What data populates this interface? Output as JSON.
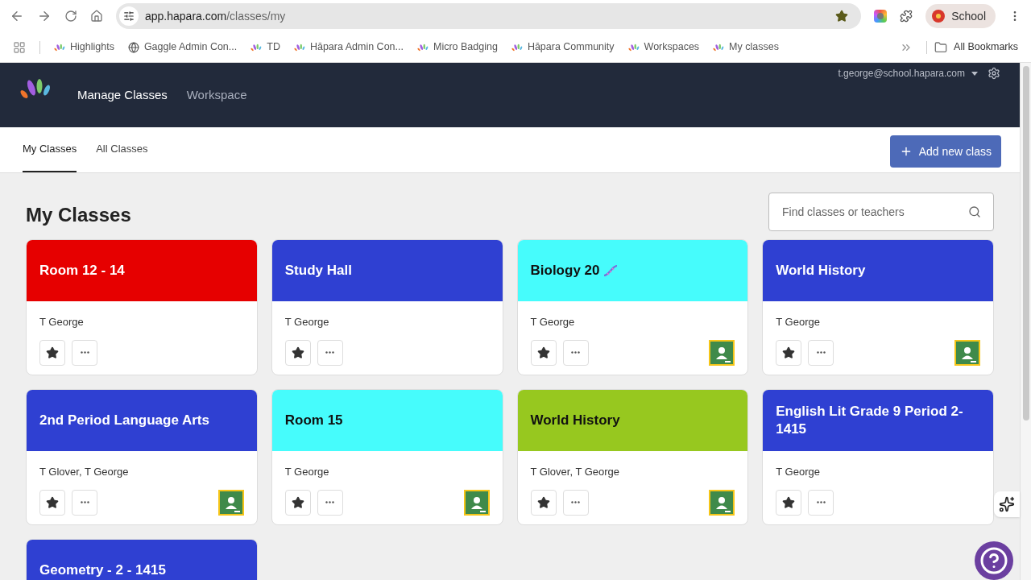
{
  "browser": {
    "url_host": "app.hapara.com",
    "url_path": "/classes/my",
    "profile": "School",
    "bookmarks": [
      {
        "label": "Highlights",
        "kind": "hapara"
      },
      {
        "label": "Gaggle Admin Con...",
        "kind": "globe"
      },
      {
        "label": "TD",
        "kind": "hapara"
      },
      {
        "label": "Hāpara Admin Con...",
        "kind": "hapara"
      },
      {
        "label": "Micro Badging",
        "kind": "hapara"
      },
      {
        "label": "Hāpara Community",
        "kind": "hapara"
      },
      {
        "label": "Workspaces",
        "kind": "hapara"
      },
      {
        "label": "My classes",
        "kind": "hapara"
      }
    ],
    "all_bookmarks": "All Bookmarks"
  },
  "header": {
    "nav": [
      {
        "label": "Manage Classes",
        "selected": true
      },
      {
        "label": "Workspace",
        "selected": false
      }
    ],
    "user": "t.george@school.hapara.com"
  },
  "tabs": [
    {
      "label": "My Classes",
      "selected": true
    },
    {
      "label": "All Classes",
      "selected": false
    }
  ],
  "add_button": "Add new class",
  "page_title": "My Classes",
  "search": {
    "placeholder": "Find classes or teachers"
  },
  "classes": [
    {
      "title": "Room 12 - 14",
      "color": "#e60000",
      "teachers": "T George",
      "dna": false,
      "classroom": false
    },
    {
      "title": "Study Hall",
      "color": "#2f40d2",
      "teachers": "T George",
      "dna": false,
      "classroom": false
    },
    {
      "title": "Biology 20",
      "color": "#46fcfc",
      "teachers": "T George",
      "dna": true,
      "classroom": true
    },
    {
      "title": "World History",
      "color": "#2f40d2",
      "teachers": "T George",
      "dna": false,
      "classroom": true
    },
    {
      "title": "2nd Period Language Arts",
      "color": "#2f40d2",
      "teachers": "T Glover, T George",
      "dna": false,
      "classroom": true
    },
    {
      "title": "Room 15",
      "color": "#46fcfc",
      "teachers": "T George",
      "dna": false,
      "classroom": true
    },
    {
      "title": "World History",
      "color": "#97c81f",
      "teachers": "T Glover, T George",
      "dna": false,
      "classroom": true
    },
    {
      "title": "English Lit Grade 9 Period 2-1415",
      "color": "#2f40d2",
      "teachers": "T George",
      "dna": false,
      "classroom": false
    },
    {
      "title": "Geometry - 2 - 1415",
      "color": "#2f40d2",
      "dna": false
    }
  ]
}
